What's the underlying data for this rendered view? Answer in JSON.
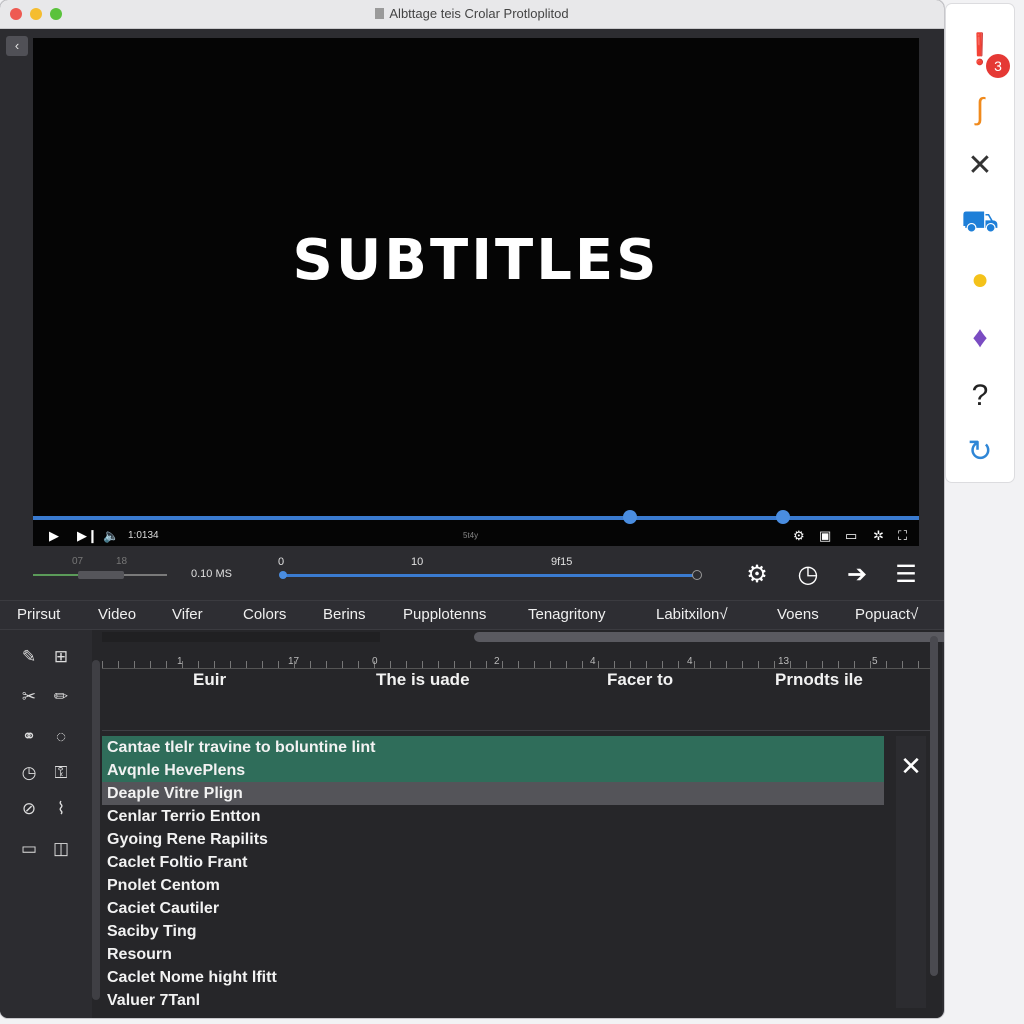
{
  "window": {
    "title": "Albttage teis Crolar Protloplitod"
  },
  "video": {
    "subtitle_text": "SUBTITLES",
    "time": "1:0134",
    "mid_label": "5t4y"
  },
  "timeline": {
    "mini_labels": [
      "07",
      "18"
    ],
    "ms_label": "0.10 MS",
    "ticks": [
      "0",
      "10",
      "9f15"
    ]
  },
  "menu": [
    "Prirsut",
    "Video",
    "Vifer",
    "Colors",
    "Berins",
    "Pupplotenns",
    "Tenagritony",
    "Labitxilon√",
    "Voens",
    "Popuact√"
  ],
  "editor": {
    "ruler_numbers": [
      "1",
      "17",
      "0",
      "2",
      "4",
      "4",
      "13",
      "5"
    ],
    "columns": [
      "Euir",
      "The is uade",
      "Facer to",
      "Prnodts ile"
    ],
    "rows": [
      "Cantae tlelr travine to boluntine  lint",
      "Avqnle HevePlens",
      "Deaple Vitre Plign",
      "Cenlar Terrio Entton",
      "Gyoing Rene Rapilits",
      "Caclet Foltio Frant",
      "Pnolet Centom",
      "Caciet Cautiler",
      "Saciby Ting",
      "Resourn",
      "Caclet Nome hight lfitt",
      "Valuer 7Tanl"
    ]
  },
  "sidebar": {
    "badge_count": "3"
  },
  "colors": {
    "accent": "#3a7bd0",
    "selection_green": "#2f6d5a",
    "selection_grey": "#545459"
  }
}
